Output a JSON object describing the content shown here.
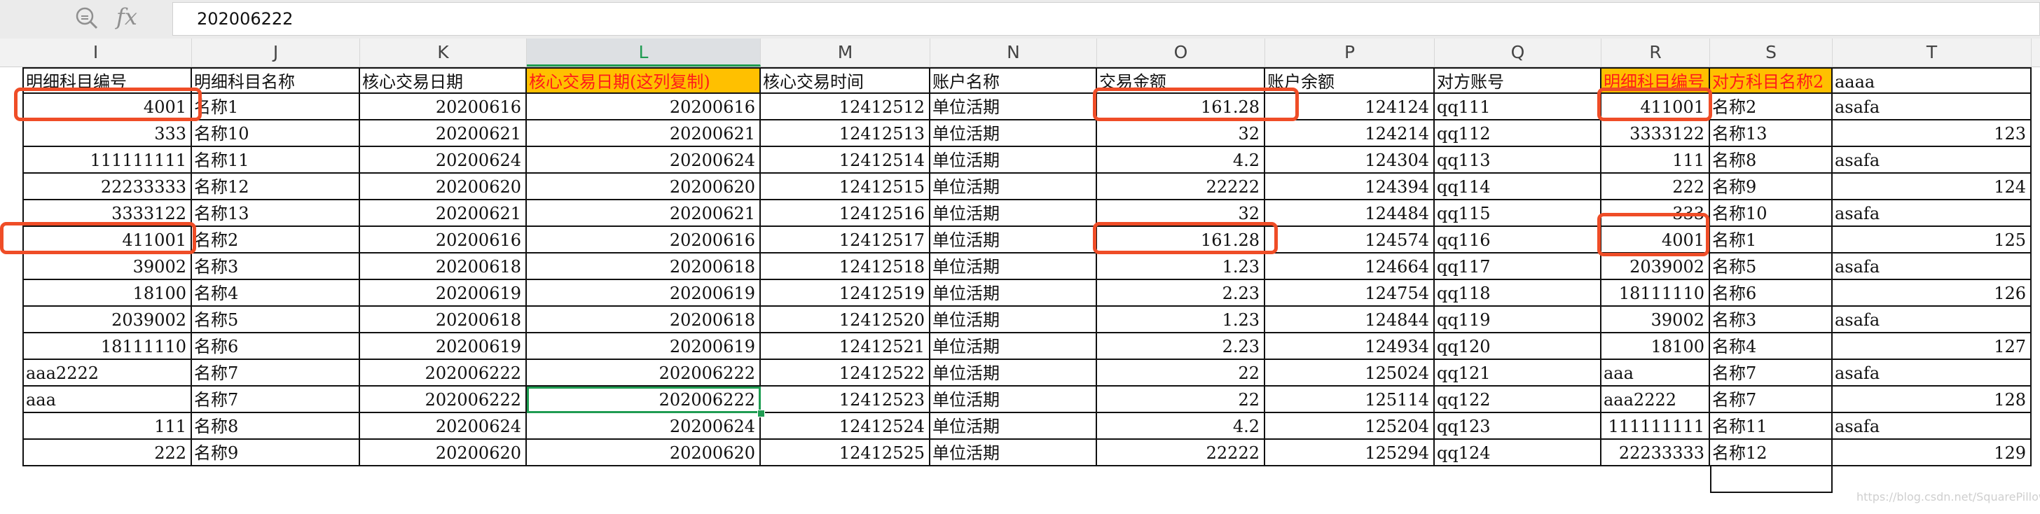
{
  "formula_bar": {
    "zoom_icon": "zoom-formula-icon",
    "fx_label": "fx",
    "value": "202006222"
  },
  "columns": [
    "I",
    "J",
    "K",
    "L",
    "M",
    "N",
    "O",
    "P",
    "Q",
    "R",
    "S",
    "T"
  ],
  "selected_column": "L",
  "header_row": [
    "明细科目编号",
    "明细科目名称",
    "核心交易日期",
    "核心交易日期(这列复制)",
    "核心交易时间",
    "账户名称",
    "交易金额",
    "账户余额",
    "对方账号",
    "明细科目编号",
    "对方科目名称2",
    "aaaa"
  ],
  "rows": [
    [
      "4001",
      "名称1",
      "20200616",
      "20200616",
      "12412512",
      "单位活期",
      "161.28",
      "124124",
      "qq111",
      "411001",
      "名称2",
      "asafa"
    ],
    [
      "333",
      "名称10",
      "20200621",
      "20200621",
      "12412513",
      "单位活期",
      "32",
      "124214",
      "qq112",
      "3333122",
      "名称13",
      "123"
    ],
    [
      "111111111",
      "名称11",
      "20200624",
      "20200624",
      "12412514",
      "单位活期",
      "4.2",
      "124304",
      "qq113",
      "111",
      "名称8",
      "asafa"
    ],
    [
      "22233333",
      "名称12",
      "20200620",
      "20200620",
      "12412515",
      "单位活期",
      "22222",
      "124394",
      "qq114",
      "222",
      "名称9",
      "124"
    ],
    [
      "3333122",
      "名称13",
      "20200621",
      "20200621",
      "12412516",
      "单位活期",
      "32",
      "124484",
      "qq115",
      "333",
      "名称10",
      "asafa"
    ],
    [
      "411001",
      "名称2",
      "20200616",
      "20200616",
      "12412517",
      "单位活期",
      "161.28",
      "124574",
      "qq116",
      "4001",
      "名称1",
      "125"
    ],
    [
      "39002",
      "名称3",
      "20200618",
      "20200618",
      "12412518",
      "单位活期",
      "1.23",
      "124664",
      "qq117",
      "2039002",
      "名称5",
      "asafa"
    ],
    [
      "18100",
      "名称4",
      "20200619",
      "20200619",
      "12412519",
      "单位活期",
      "2.23",
      "124754",
      "qq118",
      "18111110",
      "名称6",
      "126"
    ],
    [
      "2039002",
      "名称5",
      "20200618",
      "20200618",
      "12412520",
      "单位活期",
      "1.23",
      "124844",
      "qq119",
      "39002",
      "名称3",
      "asafa"
    ],
    [
      "18111110",
      "名称6",
      "20200619",
      "20200619",
      "12412521",
      "单位活期",
      "2.23",
      "124934",
      "qq120",
      "18100",
      "名称4",
      "127"
    ],
    [
      "aaa2222",
      "名称7",
      "202006222",
      "202006222",
      "12412522",
      "单位活期",
      "22",
      "125024",
      "qq121",
      "aaa",
      "名称7",
      "asafa"
    ],
    [
      "aaa",
      "名称7",
      "202006222",
      "202006222",
      "12412523",
      "单位活期",
      "22",
      "125114",
      "qq122",
      "aaa2222",
      "名称7",
      "128"
    ],
    [
      "111",
      "名称8",
      "20200624",
      "20200624",
      "12412524",
      "单位活期",
      "4.2",
      "125204",
      "qq123",
      "111111111",
      "名称11",
      "asafa"
    ],
    [
      "222",
      "名称9",
      "20200620",
      "20200620",
      "12412525",
      "单位活期",
      "22222",
      "125294",
      "qq124",
      "22233333",
      "名称12",
      "129"
    ]
  ],
  "watermark": "https://blog.csdn.net/SquarePillow",
  "colors": {
    "highlight_fill": "#ffc000",
    "highlight_text": "#ff1a1a",
    "selection": "#1f9c52",
    "callout": "#ef4d27"
  }
}
